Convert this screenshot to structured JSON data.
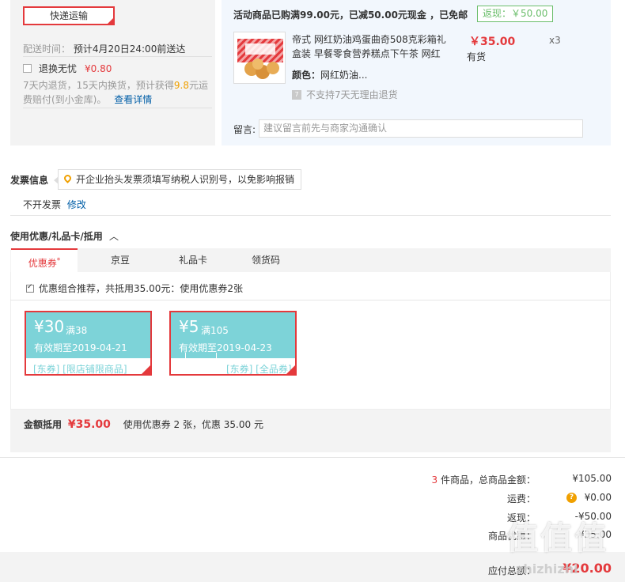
{
  "shipping": {
    "method_label": "快递运输",
    "delivery_label": "配送时间：",
    "delivery_value": "预计4月20日24:00前送达",
    "worry_free_label": "退换无忧",
    "worry_free_price": "¥0.80",
    "worry_desc_1": "7天内退货，15天内换货，预计获得",
    "worry_desc_highlight": "9.8",
    "worry_desc_2": "元运费赔付(到小金库)。",
    "details_link": "查看详情"
  },
  "promo": {
    "title": "活动商品已购满99.00元，已减50.00元现金 ，已免邮",
    "rebate_badge": "返现：￥50.00"
  },
  "product": {
    "name": "帝式 网红奶油鸡蛋曲奇508克彩箱礼盒装 早餐零食营养糕点下午茶 网红",
    "price": "￥35.00",
    "qty": "x3",
    "stock": "有货",
    "color_label": "颜色：",
    "color_value": "网红奶油...",
    "no_return_text": "不支持7天无理由退货",
    "note_label": "留言:",
    "note_placeholder": "建议留言前先与商家沟通确认"
  },
  "invoice": {
    "title": "发票信息",
    "tip": "开企业抬头发票须填写纳税人识别号，以免影响报销",
    "status": "不开发票",
    "edit_link": "修改"
  },
  "coupons": {
    "section_title": "使用优惠/礼品卡/抵用",
    "tabs": [
      {
        "label": "优惠券",
        "mark": "*"
      },
      {
        "label": "京豆"
      },
      {
        "label": "礼品卡"
      },
      {
        "label": "领货码"
      }
    ],
    "combo_text": "优惠组合推荐，共抵用35.00元：使用优惠券2张",
    "items": [
      {
        "amount": "¥30",
        "condition": "满38",
        "expiry": "有效期至2019-04-21",
        "tags": "[东券] [限店铺限商品]"
      },
      {
        "amount": "¥5",
        "condition": "满105",
        "expiry": "有效期至2019-04-23",
        "tags": "[东券] [全品券]"
      }
    ],
    "summary_label": "金额抵用",
    "summary_amount": "¥35.00",
    "summary_desc": "使用优惠券 2 张，优惠 35.00 元"
  },
  "totals": {
    "items_count": "3",
    "items_label": "件商品，总商品金额：",
    "items_value": "¥105.00",
    "freight_label": "运费：",
    "freight_icon": "?",
    "freight_value": "¥0.00",
    "rebate_label": "返现：",
    "rebate_value": "-¥50.00",
    "discount_label": "商品优惠：",
    "discount_value": "-¥35.00",
    "payable_label": "应付总额：",
    "payable_value": "¥20.00"
  },
  "watermark": {
    "text": "值值值",
    "url": "zhizhizhi"
  },
  "colors": {
    "accent_red": "#e4393c",
    "coupon_teal": "#7dd3d8",
    "rebate_green": "#6bbe6b",
    "link_blue": "#005ea7"
  }
}
